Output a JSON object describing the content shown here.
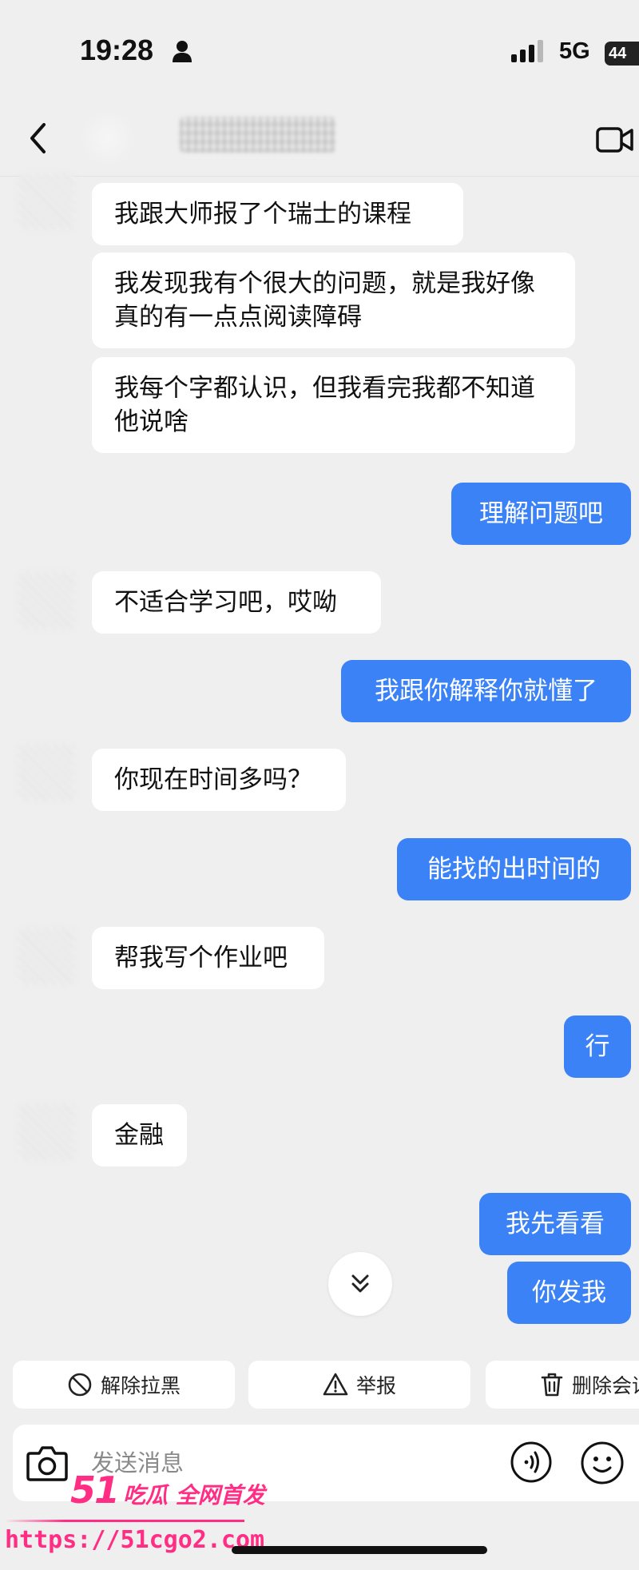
{
  "status_bar": {
    "time": "19:28",
    "network": "5G",
    "battery": "44"
  },
  "header": {
    "contact_name": ""
  },
  "messages": [
    {
      "side": "in",
      "text": "我跟大师报了个瑞士的课程"
    },
    {
      "side": "in",
      "text": "我发现我有个很大的问题，就是我好像真的有一点点阅读障碍"
    },
    {
      "side": "in",
      "text": "我每个字都认识，但我看完我都不知道他说啥"
    },
    {
      "side": "out",
      "text": "理解问题吧"
    },
    {
      "side": "in",
      "text": "不适合学习吧，哎呦"
    },
    {
      "side": "out",
      "text": "我跟你解释你就懂了"
    },
    {
      "side": "in",
      "text": "你现在时间多吗？"
    },
    {
      "side": "out",
      "text": "能找的出时间的"
    },
    {
      "side": "in",
      "text": "帮我写个作业吧"
    },
    {
      "side": "out",
      "text": "行"
    },
    {
      "side": "in",
      "text": "金融"
    },
    {
      "side": "out",
      "text": "我先看看"
    },
    {
      "side": "out",
      "text": "你发我"
    }
  ],
  "actions": {
    "unblock": "解除拉黑",
    "report": "举报",
    "delete_chat": "删除会话"
  },
  "composer": {
    "placeholder": "发送消息"
  },
  "watermark": {
    "brand_number": "51",
    "brand_text": "吃瓜 全网首发",
    "url": "https://51cgo2.com"
  },
  "colors": {
    "outgoing_bubble": "#3b82f6",
    "incoming_bubble": "#ffffff",
    "background": "#efefef",
    "watermark": "#ff2d84"
  }
}
